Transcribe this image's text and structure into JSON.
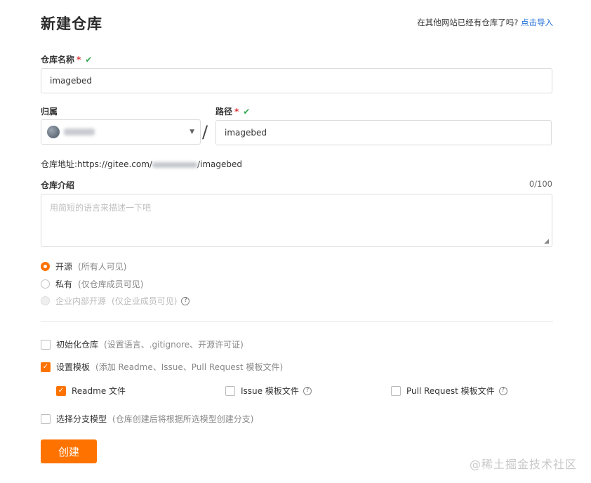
{
  "page": {
    "title": "新建仓库",
    "import_prompt": "在其他网站已经有仓库了吗?",
    "import_link": "点击导入"
  },
  "repo_name": {
    "label": "仓库名称",
    "required_mark": "*",
    "value": "imagebed"
  },
  "owner": {
    "label": "归属"
  },
  "path": {
    "label": "路径",
    "required_mark": "*",
    "value": "imagebed",
    "separator": "/"
  },
  "address": {
    "prefix": "仓库地址:https://gitee.com/",
    "suffix": "/imagebed"
  },
  "description": {
    "label": "仓库介绍",
    "counter": "0/100",
    "placeholder": "用简短的语言来描述一下吧"
  },
  "visibility": {
    "options": [
      {
        "label": "开源",
        "hint": "(所有人可见)",
        "selected": true
      },
      {
        "label": "私有",
        "hint": "(仅仓库成员可见)",
        "selected": false
      },
      {
        "label": "企业内部开源",
        "hint": "(仅企业成员可见)",
        "selected": false,
        "disabled": true
      }
    ]
  },
  "init_repo": {
    "label": "初始化仓库",
    "hint": "(设置语言、.gitignore、开源许可证)",
    "checked": false
  },
  "template": {
    "label": "设置模板",
    "hint": "(添加 Readme、Issue、Pull Request 模板文件)",
    "checked": true,
    "options": [
      {
        "label": "Readme 文件",
        "checked": true
      },
      {
        "label": "Issue 模板文件",
        "checked": false
      },
      {
        "label": "Pull Request 模板文件",
        "checked": false
      }
    ]
  },
  "branch_model": {
    "label": "选择分支模型",
    "hint": "(仓库创建后将根据所选模型创建分支)",
    "checked": false
  },
  "submit": {
    "label": "创建"
  },
  "watermark": "@稀土掘金技术社区",
  "colors": {
    "accent": "#fe7300",
    "link": "#1e6cd8",
    "valid": "#32a852",
    "required": "#e4393c"
  },
  "icons": {
    "valid": "check-icon",
    "help": "question-circle-icon",
    "dropdown": "caret-down-icon"
  }
}
